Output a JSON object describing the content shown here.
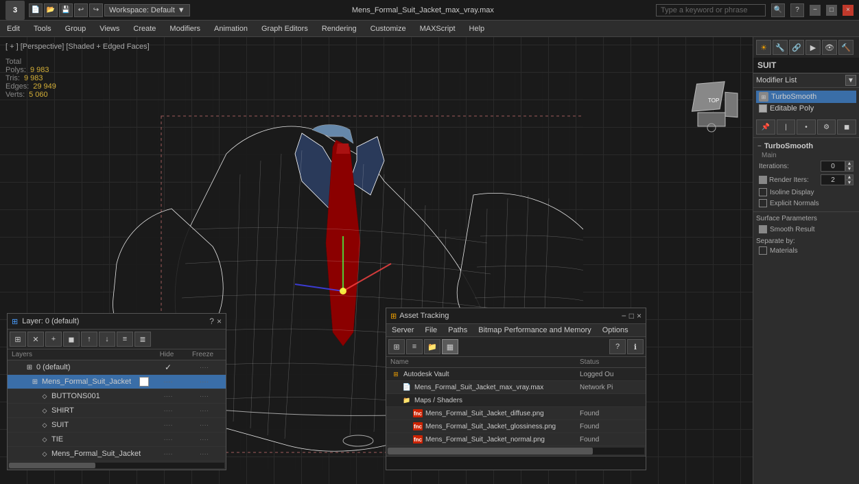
{
  "titlebar": {
    "title": "Mens_Formal_Suit_Jacket_max_vray.max",
    "workspace": "Workspace: Default",
    "search_placeholder": "Type a keyword or phrase",
    "min_label": "−",
    "max_label": "□",
    "close_label": "×"
  },
  "menubar": {
    "items": [
      "Edit",
      "Tools",
      "Group",
      "Views",
      "Create",
      "Modifiers",
      "Animation",
      "Graph Editors",
      "Rendering",
      "Customize",
      "MAXScript",
      "Help"
    ]
  },
  "viewport": {
    "label": "[ + ] [Perspective] [Shaded + Edged Faces]",
    "stats": {
      "polys_label": "Polys:",
      "polys_value": "9 983",
      "tris_label": "Tris:",
      "tris_value": "9 983",
      "edges_label": "Edges:",
      "edges_value": "29 949",
      "verts_label": "Verts:",
      "verts_value": "5 060",
      "total_label": "Total"
    }
  },
  "right_panel": {
    "object_name": "SUIT",
    "modifier_list_label": "Modifier List",
    "modifiers": [
      {
        "name": "TurboSmooth",
        "active": true
      },
      {
        "name": "Editable Poly",
        "active": false
      }
    ],
    "turbosmooth": {
      "title": "TurboSmooth",
      "sub": "Main",
      "iterations_label": "Iterations:",
      "iterations_value": "0",
      "render_iters_label": "Render Iters:",
      "render_iters_value": "2",
      "isoline_label": "Isoline Display",
      "explicit_label": "Explicit Normals",
      "surface_params_label": "Surface Parameters",
      "smooth_result_label": "Smooth Result",
      "separate_by_label": "Separate by:",
      "materials_label": "Materials"
    }
  },
  "layers_panel": {
    "title": "Layer: 0 (default)",
    "question_label": "?",
    "close_label": "×",
    "columns": {
      "name": "Layers",
      "hide": "Hide",
      "freeze": "Freeze"
    },
    "items": [
      {
        "indent": 0,
        "name": "0 (default)",
        "is_default": true,
        "active": false
      },
      {
        "indent": 1,
        "name": "Mens_Formal_Suit_Jacket",
        "active": true,
        "has_swatch": true
      },
      {
        "indent": 2,
        "name": "BUTTONS001",
        "active": false
      },
      {
        "indent": 2,
        "name": "SHIRT",
        "active": false
      },
      {
        "indent": 2,
        "name": "SUIT",
        "active": false
      },
      {
        "indent": 2,
        "name": "TIE",
        "active": false
      },
      {
        "indent": 2,
        "name": "Mens_Formal_Suit_Jacket",
        "active": false
      }
    ]
  },
  "asset_panel": {
    "title": "Asset Tracking",
    "close_label": "×",
    "min_label": "−",
    "max_label": "□",
    "menu": [
      "Server",
      "File",
      "Paths",
      "Bitmap Performance and Memory",
      "Options"
    ],
    "columns": {
      "name": "Name",
      "status": "Status"
    },
    "rows": [
      {
        "type": "vault",
        "name": "Autodesk Vault",
        "status": "Logged Ou",
        "indent": 0
      },
      {
        "type": "file",
        "name": "Mens_Formal_Suit_Jacket_max_vray.max",
        "status": "Network Pi",
        "indent": 1
      },
      {
        "type": "folder",
        "name": "Maps / Shaders",
        "status": "",
        "indent": 1
      },
      {
        "type": "img",
        "name": "Mens_Formal_Suit_Jacket_diffuse.png",
        "status": "Found",
        "indent": 2
      },
      {
        "type": "img",
        "name": "Mens_Formal_Suit_Jacket_glossiness.png",
        "status": "Found",
        "indent": 2
      },
      {
        "type": "img",
        "name": "Mens_Formal_Suit_Jacket_normal.png",
        "status": "Found",
        "indent": 2
      }
    ]
  }
}
